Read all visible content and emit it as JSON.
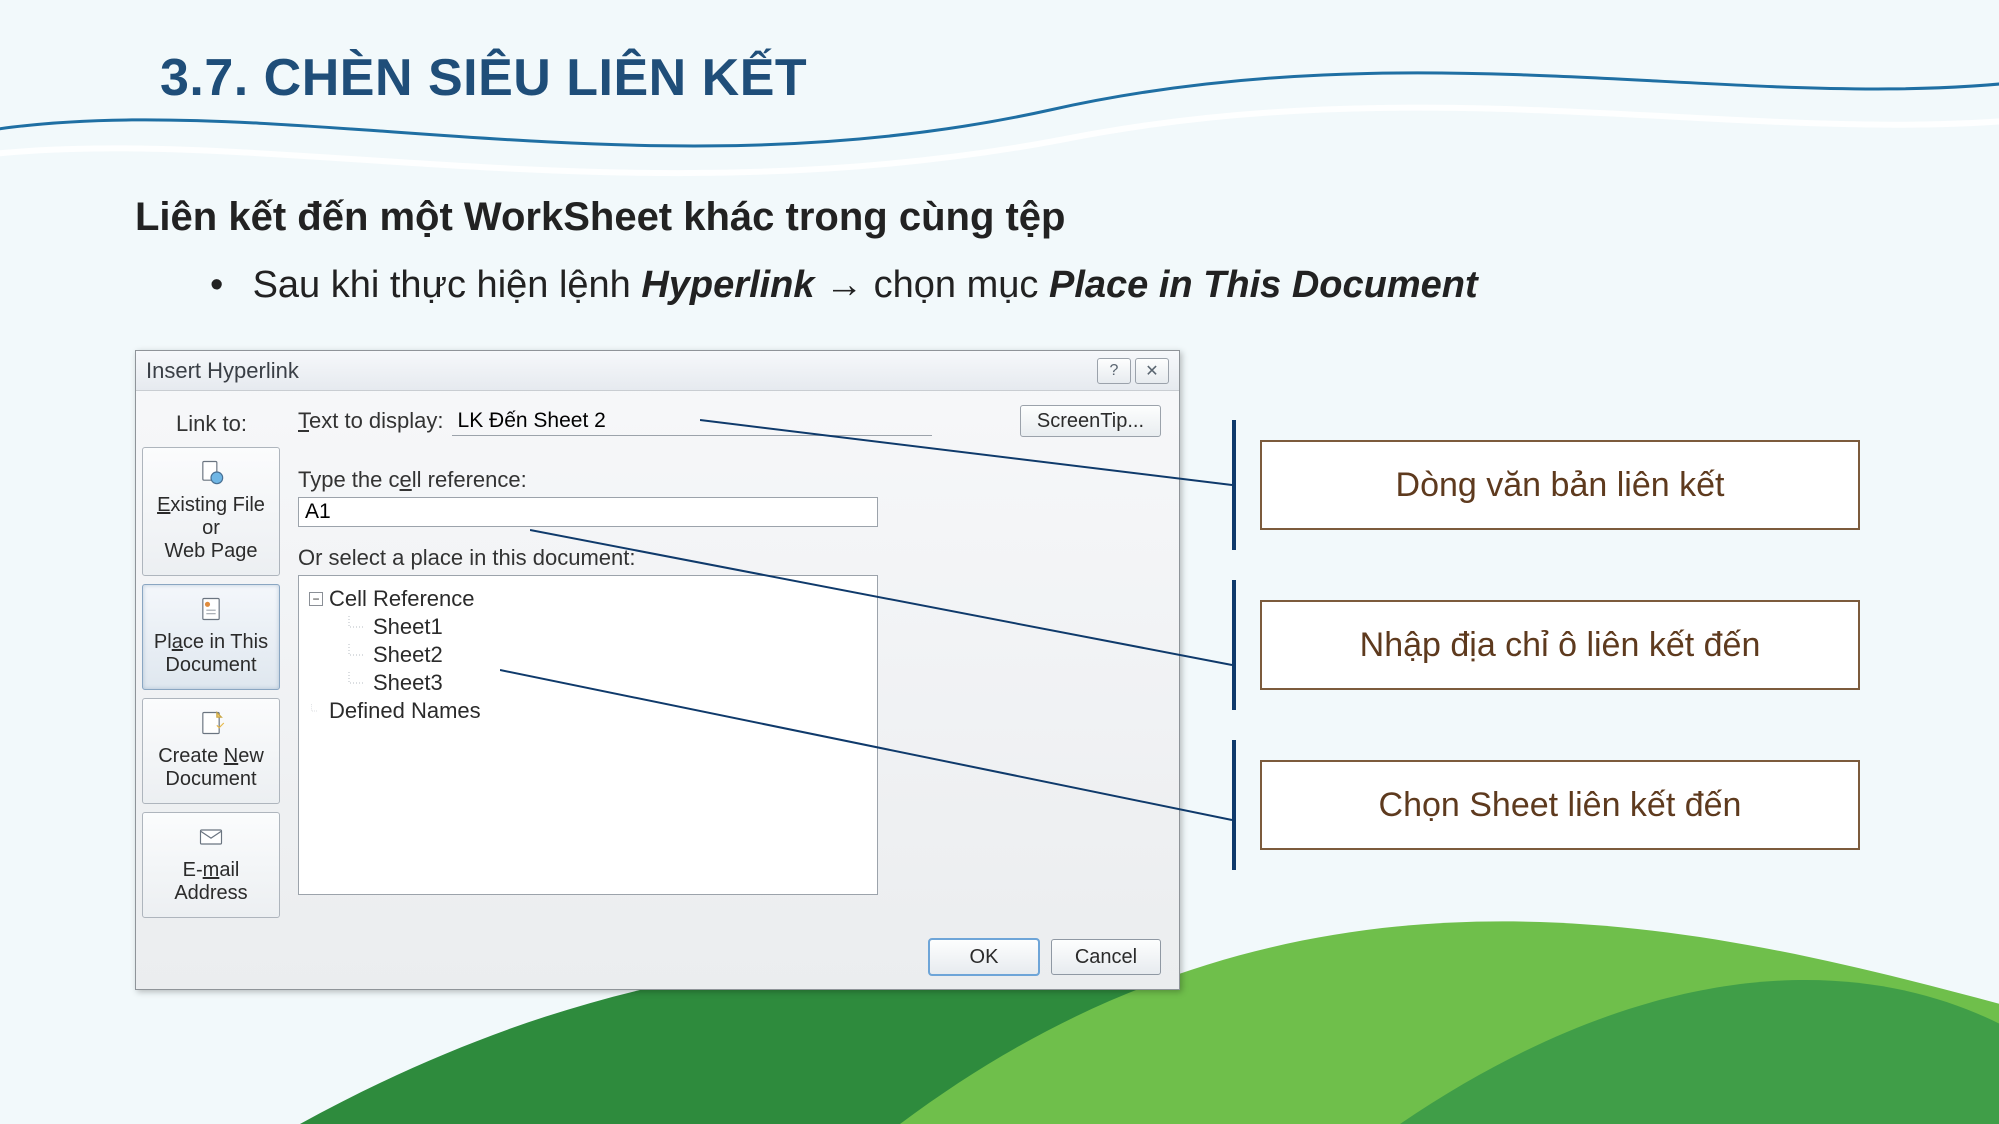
{
  "slide": {
    "title": "3.7. CHÈN SIÊU LIÊN KẾT",
    "subheading": "Liên kết đến một WorkSheet khác trong cùng tệp",
    "bullet_prefix": "Sau khi thực hiện lệnh ",
    "bullet_hyperlink": "Hyperlink",
    "bullet_arrow": " → ",
    "bullet_mid": "chọn mục ",
    "bullet_place": "Place in This Document"
  },
  "dialog": {
    "title": "Insert Hyperlink",
    "help_tip": "?",
    "close_tip": "✕",
    "link_to_label": "Link to:",
    "panel": {
      "existing_l1": "Existing File or",
      "existing_l2": "Web Page",
      "place_l1": "Place in This",
      "place_l2": "Document",
      "createnew_l1": "Create New",
      "createnew_l2": "Document",
      "email_l1": "E-mail Address"
    },
    "text_to_display_label": "Text to display:",
    "text_to_display_value": "LK Đến Sheet 2",
    "screentip_btn": "ScreenTip...",
    "cellref_label": "Type the cell reference:",
    "cellref_value": "A1",
    "selectplace_label": "Or select a place in this document:",
    "tree": {
      "root1": "Cell Reference",
      "s1": "Sheet1",
      "s2": "Sheet2",
      "s3": "Sheet3",
      "root2": "Defined Names"
    },
    "ok": "OK",
    "cancel": "Cancel"
  },
  "callouts": {
    "c1": "Dòng văn bản liên kết",
    "c2": "Nhập địa chỉ ô liên kết đến",
    "c3": "Chọn Sheet liên kết đến"
  }
}
